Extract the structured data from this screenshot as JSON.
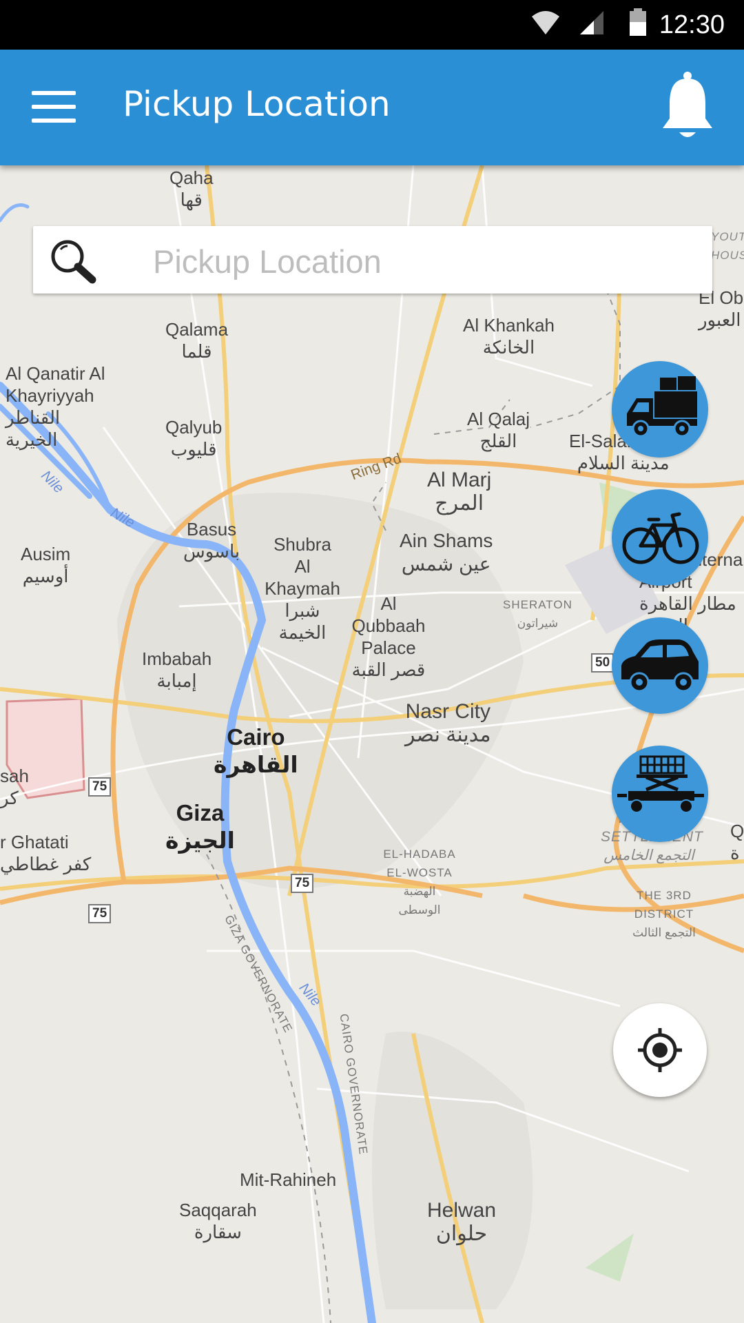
{
  "status_bar": {
    "time": "12:30"
  },
  "app_bar": {
    "title": "Pickup Location"
  },
  "search": {
    "placeholder": "Pickup Location"
  },
  "vehicles": [
    {
      "icon": "truck-icon"
    },
    {
      "icon": "bicycle-icon"
    },
    {
      "icon": "car-icon"
    },
    {
      "icon": "forklift-icon"
    }
  ],
  "map": {
    "labels": {
      "qaha_en": "Qaha",
      "qaha_ar": "قها",
      "qalama_en": "Qalama",
      "qalama_ar": "قلما",
      "qanatir_en": "Al Qanatir Al Khayriyyah",
      "qanatir_ar": "القناطر الخيرية",
      "qalyub_en": "Qalyub",
      "qalyub_ar": "قليوب",
      "khankah_en": "Al Khankah",
      "khankah_ar": "الخانكة",
      "qalaj_en": "Al Qalaj",
      "qalaj_ar": "القلج",
      "elobour_en": "El Ob",
      "elobour_ar": "العبور",
      "youth_housing": "YOUTH HOUSIN",
      "salam_en": "El-Salam City",
      "salam_ar": "مدينة السلام",
      "marj_en": "Al Marj",
      "marj_ar": "المرج",
      "ringrd": "Ring Rd",
      "basus_en": "Basus",
      "basus_ar": "باسوس",
      "ausim_en": "Ausim",
      "ausim_ar": "أوسيم",
      "shubra_en": "Shubra Al Khaymah",
      "shubra_ar": "شبرا الخيمة",
      "ainshams_en": "Ain Shams",
      "ainshams_ar": "عين شمس",
      "airport_en": "Cairo Internal Airport",
      "airport_ar": "مطار القاهرة الدولي",
      "qubbaah_en": "Al Qubbaah Palace",
      "qubbaah_ar": "قصر القبة",
      "sheraton_en": "SHERATON",
      "sheraton_ar": "شيراتون",
      "imbabah_en": "Imbabah",
      "imbabah_ar": "إمبابة",
      "nasr_en": "Nasr City",
      "nasr_ar": "مدينة نصر",
      "cairo_en": "Cairo",
      "cairo_ar": "القاهرة",
      "sah": "sah",
      "kar": "كر",
      "giza_en": "Giza",
      "giza_ar": "الجيزة",
      "ghatati_en": "r Ghatati",
      "ghatati_ar": "كفر غطاطي",
      "hadaba_en": "EL-HADABA EL-WOSTA",
      "hadaba_ar": "الهضبة الوسطى",
      "fifth_en": "THE 5TH SETTLEMENT",
      "fifth_ar": "التجمع الخامس",
      "third_en": "THE 3RD DISTRICT",
      "third_ar": "التجمع الثالث",
      "giza_gov": "GIZA GOVERNORATE",
      "cairo_gov": "CAIRO GOVERNORATE",
      "nile1": "Nile",
      "nile2": "Nile",
      "nile3": "Nile",
      "mit_en": "Mit-Rahineh",
      "saqqarah_en": "Saqqarah",
      "saqqarah_ar": "سقارة",
      "helwan_en": "Helwan",
      "helwan_ar": "حلوان",
      "q": "Q",
      "a": "ة"
    },
    "shields": {
      "r50": "50",
      "r75a": "75",
      "r75b": "75",
      "r75c": "75"
    }
  }
}
